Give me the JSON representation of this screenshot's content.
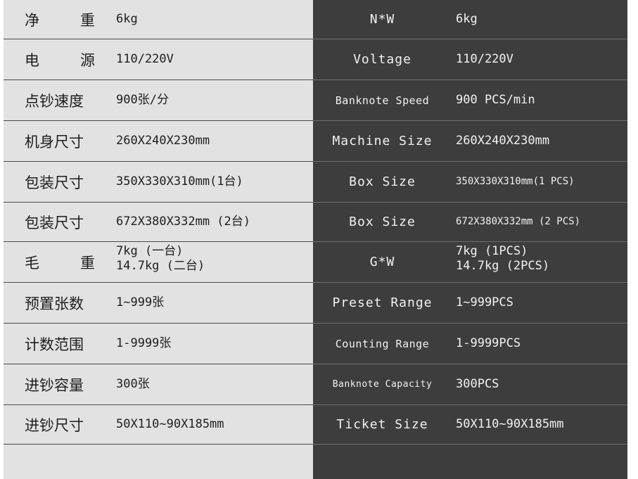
{
  "rows": [
    {
      "cn_label": "净重",
      "cn_value": "6kg",
      "en_label": "N*W",
      "en_value": "6kg"
    },
    {
      "cn_label": "电源",
      "cn_value": "110/220V",
      "en_label": "Voltage",
      "en_value": "110/220V"
    },
    {
      "cn_label": "点钞速度",
      "cn_value": "900张/分",
      "en_label": "Banknote Speed",
      "en_value": "900 PCS/min"
    },
    {
      "cn_label": "机身尺寸",
      "cn_value": "260X240X230mm",
      "en_label": "Machine Size",
      "en_value": "260X240X230mm"
    },
    {
      "cn_label": "包装尺寸",
      "cn_value": "350X330X310mm(1台)",
      "en_label": "Box Size",
      "en_value": "350X330X310mm(1 PCS)"
    },
    {
      "cn_label": "包装尺寸",
      "cn_value": "672X380X332mm (2台)",
      "en_label": "Box Size",
      "en_value": "672X380X332mm (2 PCS)"
    },
    {
      "cn_label": "毛重",
      "cn_value_line1": "7kg (一台)",
      "cn_value_line2": "14.7kg (二台)",
      "en_label": "G*W",
      "en_value_line1": "7kg (1PCS)",
      "en_value_line2": "14.7kg (2PCS)"
    },
    {
      "cn_label": "预置张数",
      "cn_value": "1~999张",
      "en_label": "Preset Range",
      "en_value": "1~999PCS"
    },
    {
      "cn_label": "计数范围",
      "cn_value": "1-9999张",
      "en_label": "Counting Range",
      "en_value": "1-9999PCS"
    },
    {
      "cn_label": "进钞容量",
      "cn_value": "300张",
      "en_label": "Banknote Capacity",
      "en_value": "300PCS"
    },
    {
      "cn_label": "进钞尺寸",
      "cn_value": "50X110~90X185mm",
      "en_label": "Ticket Size",
      "en_value": "50X110~90X185mm"
    }
  ],
  "two_char_labels": [
    {
      "a": "净",
      "b": "重"
    },
    {
      "a": "电",
      "b": "源"
    },
    {
      "a": "毛",
      "b": "重"
    }
  ],
  "colors": {
    "left_background": "#e2e2e2",
    "right_background": "#3d3d3d",
    "left_text": "#1e1e1e",
    "right_text": "#f2f2f2"
  }
}
